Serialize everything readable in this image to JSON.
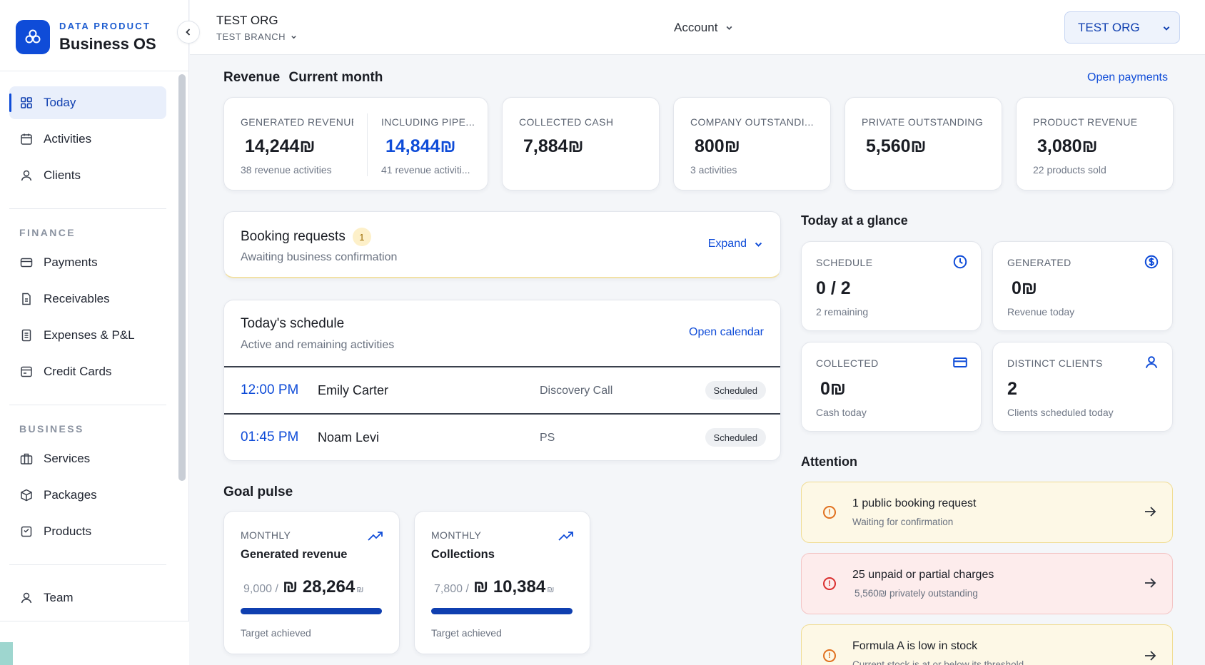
{
  "app": {
    "kicker": "DATA PRODUCT",
    "name": "Business OS"
  },
  "nav": {
    "main": [
      {
        "label": "Today",
        "icon": "grid-icon"
      },
      {
        "label": "Activities",
        "icon": "calendar-icon"
      },
      {
        "label": "Clients",
        "icon": "user-icon"
      }
    ],
    "finance_label": "FINANCE",
    "finance": [
      {
        "label": "Payments",
        "icon": "card-icon"
      },
      {
        "label": "Receivables",
        "icon": "invoice-icon"
      },
      {
        "label": "Expenses & P&L",
        "icon": "document-icon"
      },
      {
        "label": "Credit Cards",
        "icon": "credit-card-icon"
      }
    ],
    "business_label": "BUSINESS",
    "business": [
      {
        "label": "Services",
        "icon": "briefcase-icon"
      },
      {
        "label": "Packages",
        "icon": "package-icon"
      },
      {
        "label": "Products",
        "icon": "product-icon"
      }
    ],
    "team": {
      "label": "Team",
      "icon": "team-icon"
    }
  },
  "topbar": {
    "org": "TEST ORG",
    "branch": "TEST BRANCH",
    "account": "Account",
    "org_select": "TEST ORG"
  },
  "revenue": {
    "title": "Revenue",
    "subtitle": "Current month",
    "link": "Open payments",
    "generated": {
      "label": "GENERATED REVENUE",
      "value": "14,244₪",
      "sub": "38 revenue activities"
    },
    "pipeline": {
      "label": "INCLUDING PIPE...",
      "value": "14,844₪",
      "sub": "41 revenue activiti..."
    },
    "collected": {
      "label": "COLLECTED CASH",
      "value": "7,884₪"
    },
    "company": {
      "label": "COMPANY OUTSTANDI...",
      "value": "800₪",
      "sub": "3 activities"
    },
    "private": {
      "label": "PRIVATE OUTSTANDING",
      "value": "5,560₪"
    },
    "product": {
      "label": "PRODUCT REVENUE",
      "value": "3,080₪",
      "sub": "22 products sold"
    }
  },
  "booking": {
    "title": "Booking requests",
    "count": "1",
    "sub": "Awaiting business confirmation",
    "expand": "Expand"
  },
  "schedule": {
    "title": "Today's schedule",
    "sub": "Active and remaining activities",
    "link": "Open calendar",
    "rows": [
      {
        "time": "12:00 PM",
        "name": "Emily Carter",
        "type": "Discovery Call",
        "status": "Scheduled"
      },
      {
        "time": "01:45 PM",
        "name": "Noam Levi",
        "type": "PS",
        "status": "Scheduled"
      }
    ]
  },
  "goals": {
    "title": "Goal pulse",
    "items": [
      {
        "period": "MONTHLY",
        "name": "Generated revenue",
        "target": "9,000 /",
        "value": "₪ 28,264",
        "unit": "₪",
        "status": "Target achieved",
        "progress": 1.0
      },
      {
        "period": "MONTHLY",
        "name": "Collections",
        "target": "7,800 /",
        "value": "₪ 10,384",
        "unit": "₪",
        "status": "Target achieved",
        "progress": 1.0
      }
    ]
  },
  "glance": {
    "title": "Today at a glance",
    "schedule": {
      "label": "SCHEDULE",
      "value": "0 / 2",
      "sub": "2 remaining"
    },
    "generated": {
      "label": "GENERATED",
      "value": "0₪",
      "sub": "Revenue today"
    },
    "collected": {
      "label": "COLLECTED",
      "value": "0₪",
      "sub": "Cash today"
    },
    "clients": {
      "label": "DISTINCT CLIENTS",
      "value": "2",
      "sub": "Clients scheduled today"
    }
  },
  "attention": {
    "title": "Attention",
    "items": [
      {
        "title": "1 public booking request",
        "sub": "Waiting for confirmation",
        "tone": "warning"
      },
      {
        "title": "25 unpaid or partial charges",
        "sub": "5,560₪ privately outstanding",
        "tone": "danger"
      },
      {
        "title": "Formula A is low in stock",
        "sub": "Current stock is at or below its threshold",
        "tone": "warning"
      }
    ]
  },
  "colors": {
    "accent": "#0f4cd8",
    "warning_bg": "#fdf8e6",
    "danger_bg": "#fdecec"
  }
}
